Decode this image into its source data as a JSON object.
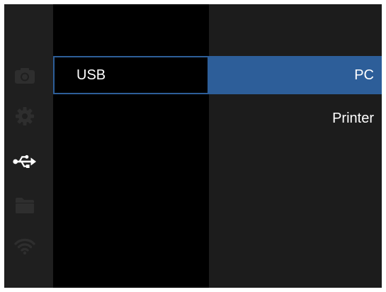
{
  "colors": {
    "accent": "#2d5e99",
    "screen_bg": "#000000",
    "rail_bg": "#1f1f1f",
    "options_bg": "#1c1c1c",
    "inactive_icon": "#2e2e2e",
    "active_icon": "#ffffff",
    "text": "#ffffff"
  },
  "rail": {
    "icons": [
      {
        "name": "camera-icon",
        "active": false
      },
      {
        "name": "gear-icon",
        "active": false
      },
      {
        "name": "usb-icon",
        "active": true
      },
      {
        "name": "folder-icon",
        "active": false
      },
      {
        "name": "wifi-icon",
        "active": false
      }
    ]
  },
  "menu": {
    "items": [
      {
        "label": "USB",
        "focused": true
      }
    ]
  },
  "options": {
    "items": [
      {
        "label": "PC",
        "selected": true
      },
      {
        "label": "Printer",
        "selected": false
      }
    ]
  }
}
